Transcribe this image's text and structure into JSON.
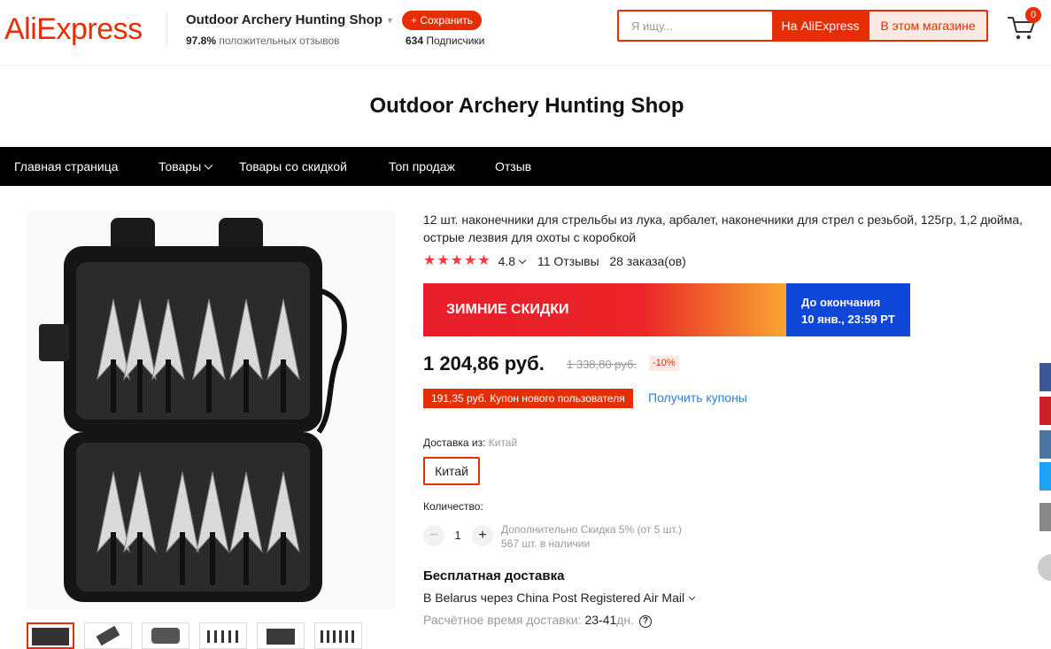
{
  "header": {
    "logo": "AliExpress",
    "shop_name": "Outdoor Archery Hunting Shop",
    "positive_pct": "97.8%",
    "positive_label": "положительных отзывов",
    "save_label": "+ Сохранить",
    "subscribers_count": "634",
    "subscribers_label": "Подписчики",
    "search_placeholder": "Я ищу...",
    "search_ali_label": "На AliExpress",
    "search_store_label": "В этом магазине",
    "cart_count": "0"
  },
  "store_title": "Outdoor Archery Hunting Shop",
  "nav": {
    "items": [
      {
        "label": "Главная страница"
      },
      {
        "label": "Товары"
      },
      {
        "label": "Товары со скидкой"
      },
      {
        "label": "Топ продаж"
      },
      {
        "label": "Отзыв"
      }
    ]
  },
  "product": {
    "title": "12 шт. наконечники для стрельбы из лука, арбалет, наконечники для стрел с резьбой, 125гр, 1,2 дюйма, острые лезвия для охоты с коробкой",
    "stars": "★★★★★",
    "rating": "4.8",
    "reviews": "11 Отзывы",
    "orders": "28 заказа(ов)",
    "banner_title": "ЗИМНИЕ СКИДКИ",
    "banner_until": "До окончания",
    "banner_date": "10 янв., 23:59 PT",
    "price": "1 204,86 руб.",
    "old_price": "1 338,80 руб.",
    "discount": "-10%",
    "coupon": "191,35 руб. Купон нового пользователя",
    "get_coupons": "Получить купоны",
    "ship_from_label": "Доставка из:",
    "ship_from_value": "Китай",
    "country_option": "Китай",
    "qty_label": "Количество:",
    "qty_minus": "−",
    "qty_value": "1",
    "qty_plus": "+",
    "qty_note1": "Дополнительно Скидка 5% (от 5 шт.)",
    "qty_note2": "567 шт. в наличии",
    "free_shipping": "Бесплатная доставка",
    "ship_via": "В Belarus через China Post Registered Air Mail",
    "eta_label": "Расчётное время доставки:",
    "eta_value": "23-41",
    "eta_unit": "дн.",
    "eta_help": "?"
  },
  "social": [
    {
      "name": "facebook-icon",
      "color": "#3b5998"
    },
    {
      "name": "pinterest-icon",
      "color": "#cb2027"
    },
    {
      "name": "vk-icon",
      "color": "#4c75a3"
    },
    {
      "name": "twitter-icon",
      "color": "#1da1f2"
    },
    {
      "name": "more-icon",
      "color": "#888888"
    }
  ],
  "colors": {
    "accent": "#e62e04",
    "nav_bg": "#000000",
    "banner_blue": "#0f47d8",
    "link": "#2e7de1"
  }
}
